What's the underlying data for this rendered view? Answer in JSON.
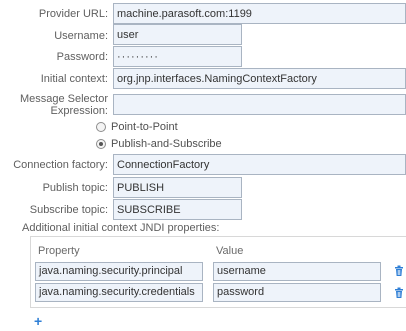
{
  "form": {
    "provider_url_label": "Provider URL:",
    "provider_url_value": "machine.parasoft.com:1199",
    "username_label": "Username:",
    "username_value": "user",
    "password_label": "Password:",
    "password_value": "·········",
    "initial_context_label": "Initial context:",
    "initial_context_value": "org.jnp.interfaces.NamingContextFactory",
    "message_selector_label_line1": "Message Selector",
    "message_selector_label_line2": "Expression:",
    "message_selector_value": "",
    "radio_point_to_point": "Point-to-Point",
    "radio_publish_subscribe": "Publish-and-Subscribe",
    "selected_radio": "Publish-and-Subscribe",
    "connection_factory_label": "Connection factory:",
    "connection_factory_value": "ConnectionFactory",
    "publish_topic_label": "Publish topic:",
    "publish_topic_value": "PUBLISH",
    "subscribe_topic_label": "Subscribe topic:",
    "subscribe_topic_value": "SUBSCRIBE"
  },
  "jndi": {
    "section_title": "Additional initial context JNDI properties:",
    "col_property": "Property",
    "col_value": "Value",
    "rows": [
      {
        "property": "java.naming.security.principal",
        "value": "username"
      },
      {
        "property": "java.naming.security.credentials",
        "value": "password"
      }
    ],
    "add_icon": "plus-icon",
    "delete_icon": "trash-icon"
  },
  "colors": {
    "field_bg": "#eef3fa",
    "field_border": "#a9b4c2",
    "accent": "#2f7fd6"
  }
}
